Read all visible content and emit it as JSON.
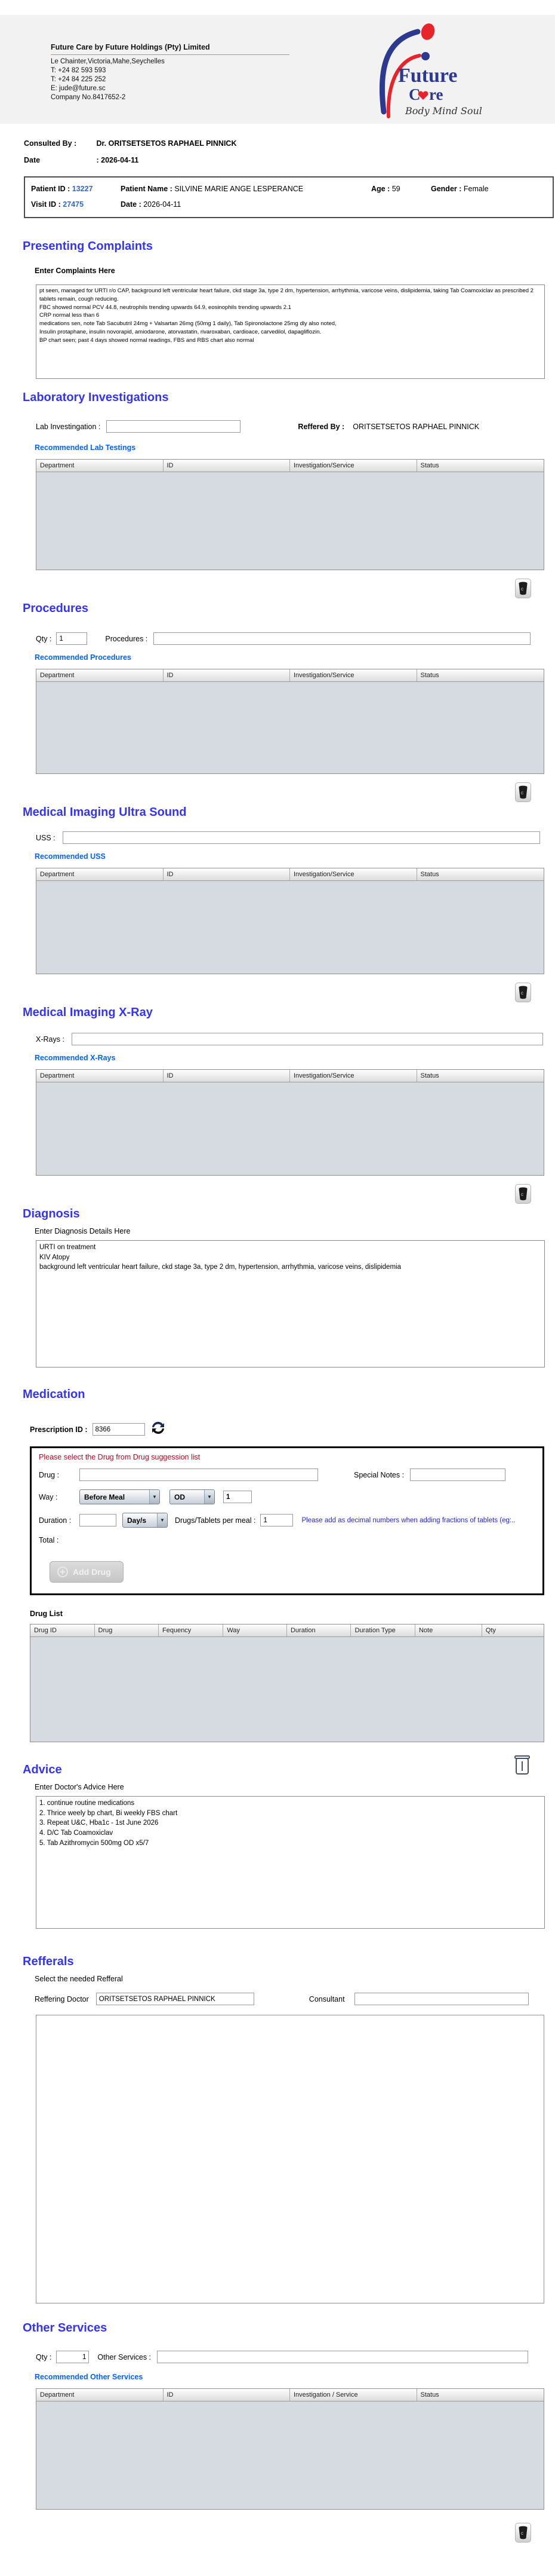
{
  "colors": {
    "section_heading": "#3333ff",
    "recommended_label": "#0062ff",
    "patient_id_accent": "#3366cc",
    "notice_red": "#cc0022",
    "note_blue": "#2222ff",
    "table_body_gray": "#d6dae1",
    "logo_blue": "#2b3990",
    "logo_red": "#e8232a"
  },
  "icons": {
    "delete": "trash-recycle-icon",
    "refresh": "refresh-arrows-icon",
    "add": "plus-circle-icon",
    "dropdown": "chevron-down-icon",
    "advice_delete": "trash-outline-icon"
  },
  "header": {
    "company_name": "Future Care by Future Holdings (Pty) Limited",
    "address": "Le Chainter,Victoria,Mahe,Seychelles",
    "phone1": "T: +24  82 593 593",
    "phone2": "T: +24  84 225 252",
    "email": "E: jude@future.sc",
    "company_no": "Company No.8417652-2",
    "logo_line1": "Future",
    "logo_line2": "Care",
    "logo_tagline": "Body Mind Soul"
  },
  "consult": {
    "consulted_by_label": "Consulted By :",
    "consulted_by_value": "Dr.  ORITSETSETOS RAPHAEL PINNICK",
    "date_label": "Date",
    "date_value": ": 2026-04-11"
  },
  "patient": {
    "id_label": "Patient ID :",
    "id_value": "13227",
    "name_label": "Patient Name :",
    "name_value": "SILVINE MARIE ANGE LESPERANCE",
    "age_label": "Age :",
    "age_value": "59",
    "gender_label": "Gender :",
    "gender_value": "Female",
    "visit_id_label": "Visit ID :",
    "visit_id_value": "27475",
    "visit_date_label": "Date :",
    "visit_date_value": "2026-04-11"
  },
  "complaints": {
    "title": "Presenting Complaints",
    "entry_label": "Enter Complaints Here",
    "text": "pt seen, managed for URTI r/o CAP, background left ventricular heart failure, ckd stage 3a, type 2 dm, hypertension, arrhythmia, varicose veins, dislipidemia, taking Tab Coamoxiclav as prescribed 2 tablets remain, cough reducing.\nFBC showed normal PCV 44.8, neutrophils trending upwards 64.9, eosinophils trending upwards 2.1\nCRP normal less than 6\nmedications sen, note Tab Sacubutril 24mg + Valsartan 26mg (50mg 1 daily), Tab Spironolactone 25mg dly also noted,\nInsulin protaphane, insulin novorapid, amiodarone, atorvastatin, rivaroxaban, cardioace, carvedilol, dapagliflozin.\nBP chart seen; past 4 days showed normal readings, FBS and RBS chart also normal"
  },
  "lab": {
    "title": "Laboratory  Investigations",
    "input_label": "Lab Investingation :",
    "input_value": "",
    "referred_by_label": "Reffered By :",
    "referred_by_value": "ORITSETSETOS RAPHAEL PINNICK",
    "recommended_label": "Recommended Lab Testings",
    "headers": [
      "Department",
      "ID",
      "Investigation/Service",
      "Status"
    ]
  },
  "procedures": {
    "title": "Procedures",
    "qty_label": "Qty :",
    "qty_value": "1",
    "input_label": "Procedures :",
    "input_value": "",
    "recommended_label": "Recommended Procedures",
    "headers": [
      "Department",
      "ID",
      "Investigation/Service",
      "Status"
    ]
  },
  "uss": {
    "title": "Medical Imaging Ultra Sound",
    "input_label": "USS :",
    "input_value": "",
    "recommended_label": "Recommended USS",
    "headers": [
      "Department",
      "ID",
      "Investigation/Service",
      "Status"
    ]
  },
  "xray": {
    "title": "Medical Imaging X-Ray",
    "input_label": "X-Rays :",
    "input_value": "",
    "recommended_label": "Recommended X-Rays",
    "headers": [
      "Department",
      "ID",
      "Investigation/Service",
      "Status"
    ]
  },
  "diagnosis": {
    "title": "Diagnosis",
    "entry_label": "Enter Diagnosis Details Here",
    "text": "URTI on treatment\nKIV Atopy\nbackground left ventricular heart failure, ckd stage 3a, type 2 dm, hypertension, arrhythmia, varicose veins, dislipidemia"
  },
  "medication": {
    "title": "Medication",
    "prescription_label": "Prescription ID :",
    "prescription_id": "8366",
    "notice": "Please select the Drug from Drug suggession list",
    "drug_label": "Drug :",
    "drug_value": "",
    "special_notes_label": "Special Notes :",
    "special_notes_value": "",
    "way_label": "Way :",
    "way_value": "Before Meal",
    "frequency_value": "OD",
    "frequency_qty": "1",
    "duration_label": "Duration :",
    "duration_value": "",
    "duration_unit": "Day/s",
    "per_meal_label": "Drugs/Tablets per meal :",
    "per_meal_value": "1",
    "fraction_note": "Please add as decimal numbers when adding fractions of tablets (eg:..",
    "total_label": "Total :",
    "add_drug_label": "Add Drug",
    "drug_list_label": "Drug List",
    "headers": [
      "Drug ID",
      "Drug",
      "Fequency",
      "Way",
      "Duration",
      "Duration Type",
      "Note",
      "Qty"
    ]
  },
  "advice": {
    "title": "Advice",
    "entry_label": "Enter Doctor's Advice Here",
    "text": "1. continue routine medications\n2. Thrice weely bp chart, Bi weekly FBS chart\n3. Repeat U&C, Hba1c - 1st June 2026\n4. D/C Tab Coamoxiclav\n5. Tab Azithromycin 500mg OD x5/7"
  },
  "referrals": {
    "title": "Refferals",
    "entry_label": "Select the needed Refferal",
    "referring_doctor_label": "Reffering Doctor",
    "referring_doctor_value": "ORITSETSETOS RAPHAEL PINNICK",
    "consultant_label": "Consultant",
    "consultant_value": ""
  },
  "other_services": {
    "title": "Other Services",
    "qty_label": "Qty :",
    "qty_value": "1",
    "input_label": "Other Services :",
    "input_value": "",
    "recommended_label": "Recommended Other Services",
    "headers": [
      "Department",
      "ID",
      "Investigation / Service",
      "Status"
    ]
  }
}
